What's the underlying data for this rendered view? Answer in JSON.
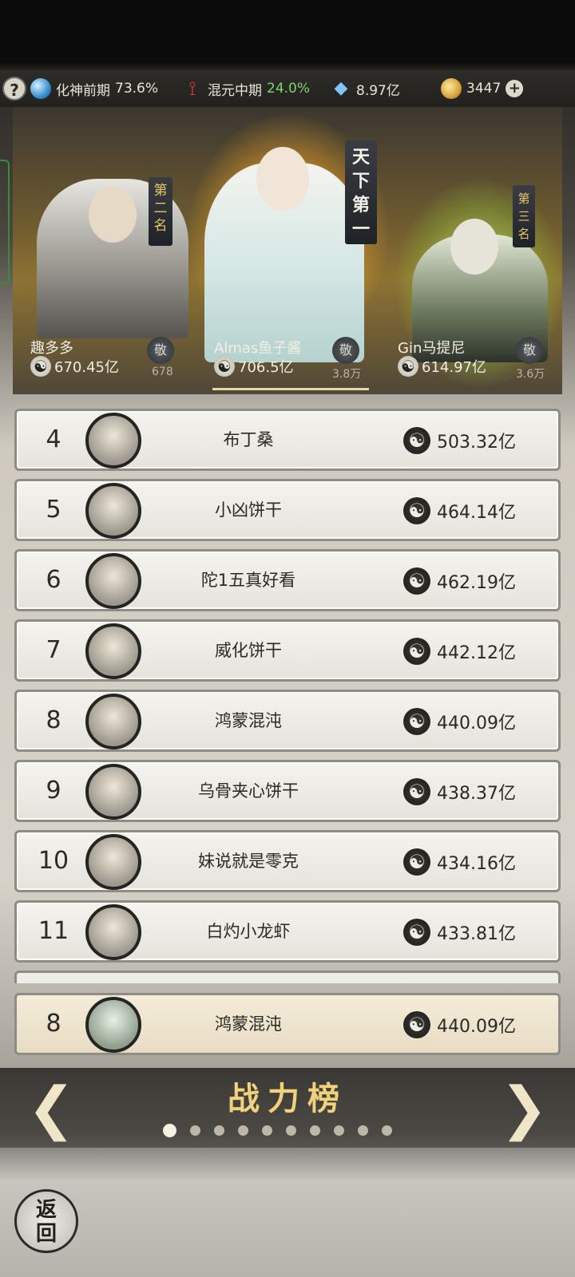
{
  "topbar": {
    "stat1": {
      "label": "化神前期",
      "pct": "73.6%"
    },
    "stat2": {
      "label": "混元中期",
      "pct": "24.0%"
    },
    "stat3": {
      "value": "8.97亿"
    },
    "stat4": {
      "value": "3447"
    },
    "plus_label": "+",
    "help_label": "?"
  },
  "podium": {
    "banners": {
      "first": "天下第一",
      "second": "第二名",
      "third": "第三名"
    },
    "cards": [
      {
        "name": "趣多多",
        "power": "670.45亿",
        "respect_label": "敬",
        "respect_count": "678"
      },
      {
        "name": "Almas鱼子酱",
        "power": "706.5亿",
        "respect_label": "敬",
        "respect_count": "3.8万"
      },
      {
        "name": "Gin马提尼",
        "power": "614.97亿",
        "respect_label": "敬",
        "respect_count": "3.6万"
      }
    ]
  },
  "rows": [
    {
      "rank": "4",
      "name": "布丁桑",
      "power": "503.32亿"
    },
    {
      "rank": "5",
      "name": "小凶饼干",
      "power": "464.14亿"
    },
    {
      "rank": "6",
      "name": "陀1五真好看",
      "power": "462.19亿"
    },
    {
      "rank": "7",
      "name": "威化饼干",
      "power": "442.12亿"
    },
    {
      "rank": "8",
      "name": "鸿蒙混沌",
      "power": "440.09亿"
    },
    {
      "rank": "9",
      "name": "乌骨夹心饼干",
      "power": "438.37亿"
    },
    {
      "rank": "10",
      "name": "妹说就是零克",
      "power": "434.16亿"
    },
    {
      "rank": "11",
      "name": "白灼小龙虾",
      "power": "433.81亿"
    }
  ],
  "self_row": {
    "rank": "8",
    "name": "鸿蒙混沌",
    "power": "440.09亿"
  },
  "nav": {
    "title": "战力榜",
    "prev_glyph": "❮",
    "next_glyph": "❯",
    "page_count": 10,
    "active_page": 1
  },
  "back_button": {
    "line1": "返",
    "line2": "回"
  },
  "icons": {
    "power": "yin-yang-icon",
    "stat1": "blue-orb-icon",
    "stat2": "red-trident-icon",
    "stat3": "crystal-icon",
    "stat4": "gold-coin-icon"
  },
  "colors": {
    "accent_gold": "#f0d27c",
    "pct_green": "#7fd36d",
    "row_bg": "#f4f3ee",
    "self_row_bg": "#f4ecd9"
  }
}
